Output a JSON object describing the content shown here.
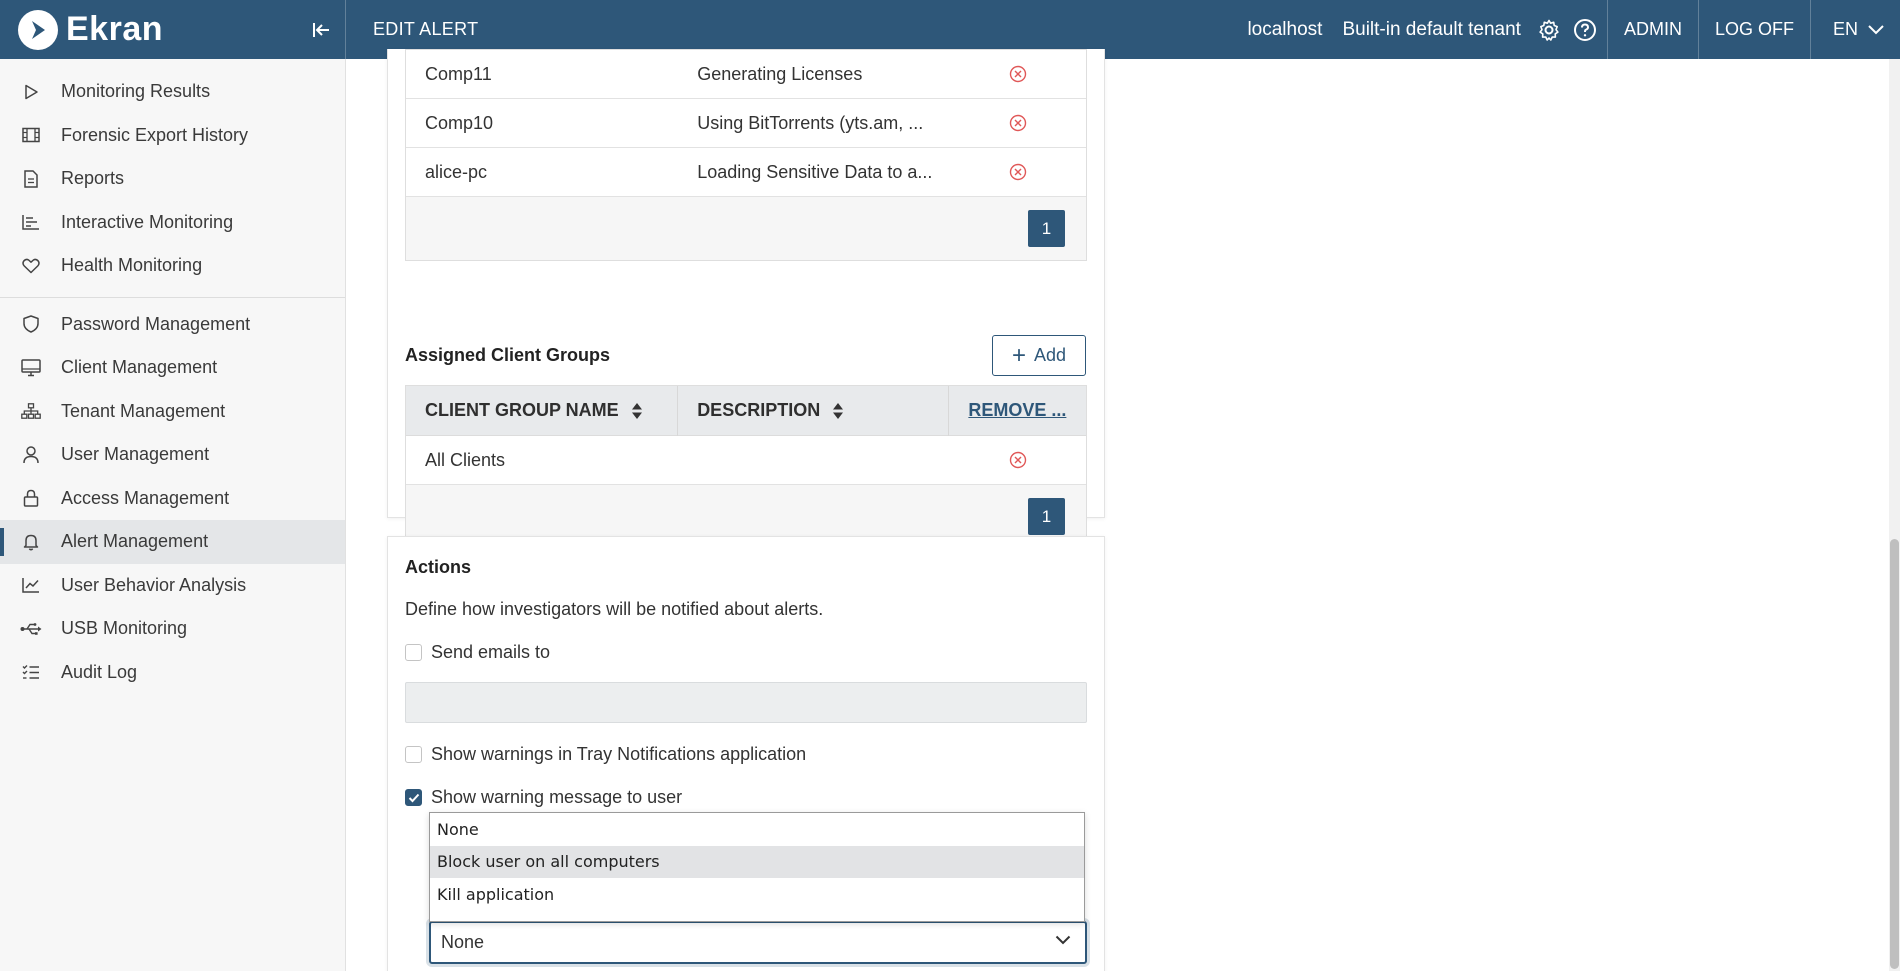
{
  "header": {
    "logo_text": "Ekran",
    "page_title": "EDIT ALERT",
    "host": "localhost",
    "tenant": "Built-in default tenant",
    "user": "ADMIN",
    "logoff": "LOG OFF",
    "language": "EN",
    "color": "#2e5779"
  },
  "sidebar": {
    "group1": [
      {
        "label": "Monitoring Results",
        "icon": "play-icon"
      },
      {
        "label": "Forensic Export History",
        "icon": "film-icon"
      },
      {
        "label": "Reports",
        "icon": "document-icon"
      },
      {
        "label": "Interactive Monitoring",
        "icon": "bar-chart-icon"
      },
      {
        "label": "Health Monitoring",
        "icon": "heart-icon"
      }
    ],
    "group2": [
      {
        "label": "Password Management",
        "icon": "shield-icon"
      },
      {
        "label": "Client Management",
        "icon": "monitor-icon"
      },
      {
        "label": "Tenant Management",
        "icon": "hierarchy-icon"
      },
      {
        "label": "User Management",
        "icon": "user-icon"
      },
      {
        "label": "Access Management",
        "icon": "lock-icon"
      },
      {
        "label": "Alert Management",
        "icon": "bell-icon",
        "active": true
      },
      {
        "label": "User Behavior Analysis",
        "icon": "trend-icon"
      },
      {
        "label": "USB Monitoring",
        "icon": "usb-icon"
      },
      {
        "label": "Audit Log",
        "icon": "checklist-icon"
      }
    ]
  },
  "clients_table": {
    "rows": [
      {
        "name": "Comp11",
        "description": "Generating Licenses"
      },
      {
        "name": "Comp10",
        "description": "Using BitTorrents (yts.am, ..."
      },
      {
        "name": "alice-pc",
        "description": "Loading Sensitive Data to a..."
      }
    ],
    "page": "1"
  },
  "client_groups": {
    "title": "Assigned Client Groups",
    "add_label": "Add",
    "columns": {
      "name": "CLIENT GROUP NAME",
      "description": "DESCRIPTION",
      "remove": "REMOVE ..."
    },
    "rows": [
      {
        "name": "All Clients",
        "description": ""
      }
    ],
    "page": "1"
  },
  "actions": {
    "title": "Actions",
    "description": "Define how investigators will be notified about alerts.",
    "send_emails_label": "Send emails to",
    "send_emails_checked": false,
    "email_value": "",
    "tray_label": "Show warnings in Tray Notifications application",
    "tray_checked": false,
    "warning_label": "Show warning message to user",
    "warning_checked": true,
    "dropdown_options": [
      "None",
      "Block user on all computers",
      "Kill application"
    ],
    "highlighted_option": "Block user on all computers",
    "selected_value": "None"
  }
}
